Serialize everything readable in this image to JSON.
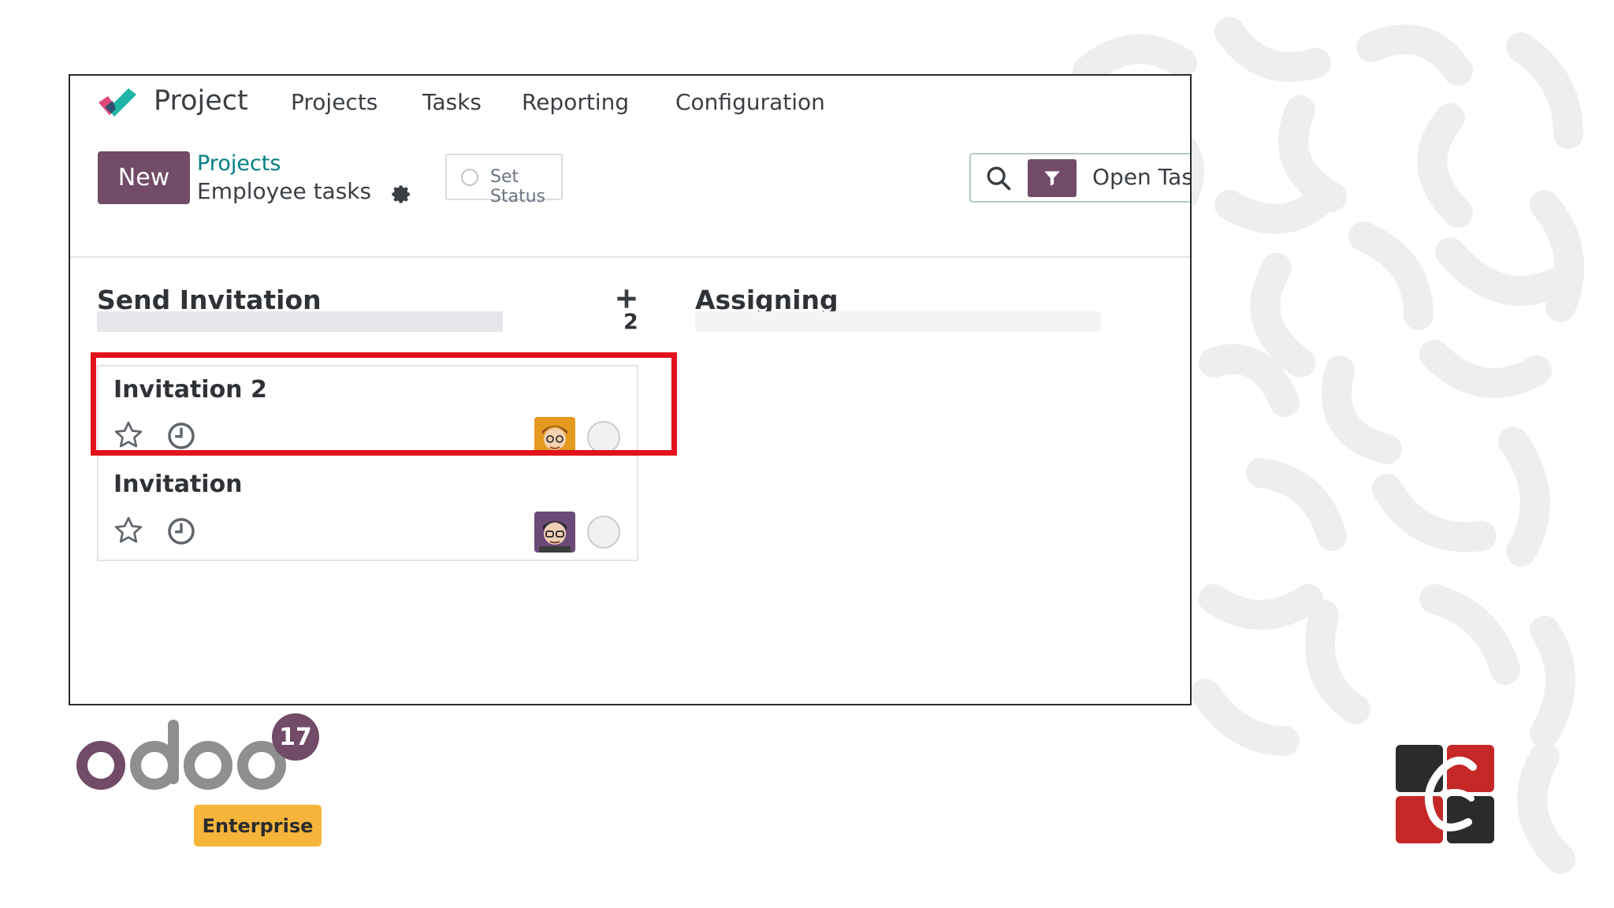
{
  "navbar": {
    "app_name": "Project",
    "menu": [
      "Projects",
      "Tasks",
      "Reporting",
      "Configuration"
    ]
  },
  "control_panel": {
    "new_label": "New",
    "breadcrumb_parent": "Projects",
    "breadcrumb_current": "Employee tasks",
    "set_status_label": "Set Status",
    "search_facet": "Open Tas"
  },
  "kanban": {
    "columns": [
      {
        "title": "Send Invitation",
        "count": "2",
        "cards": [
          {
            "title": "Invitation 2",
            "avatar": "avatar-orange"
          },
          {
            "title": "Invitation",
            "avatar": "avatar-purple"
          }
        ]
      },
      {
        "title": "Assigning",
        "count": "",
        "cards": []
      }
    ]
  },
  "branding": {
    "version": "17",
    "edition": "Enterprise"
  },
  "colors": {
    "primary": "#714b67",
    "link": "#017e84",
    "highlight": "#e3121b",
    "enterprise_badge": "#f6b43b"
  },
  "icons": [
    "app-logo-icon",
    "gear-icon",
    "search-icon",
    "filter-icon",
    "add-icon",
    "star-icon",
    "clock-icon",
    "state-circle",
    "odoo-logo",
    "company-logo"
  ]
}
